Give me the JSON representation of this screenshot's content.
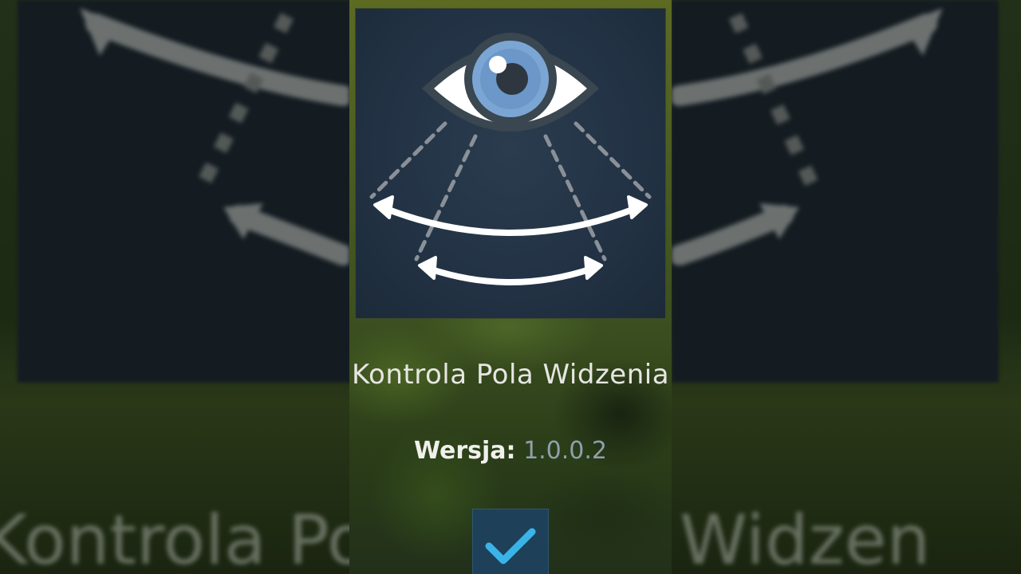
{
  "app": {
    "name": "Kontrola Pola Widzenia",
    "version_label": "Wersja:",
    "version_value": "1.0.0.2"
  },
  "icons": {
    "app_icon": "eye-field-of-view-icon",
    "confirm_icon": "checkmark-icon"
  },
  "colors": {
    "tile_background": "#223244",
    "iris": "#7ba6d4",
    "checkmark": "#3ab4e8",
    "version_value": "#8fa0ac"
  }
}
